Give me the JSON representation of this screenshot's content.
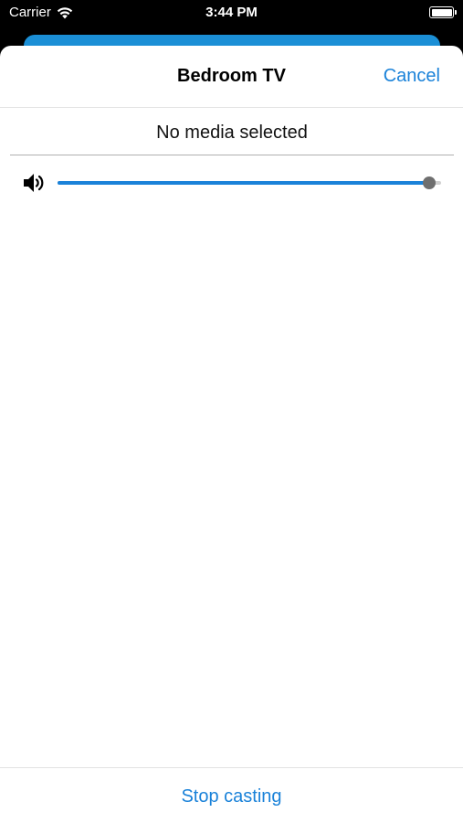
{
  "status_bar": {
    "carrier": "Carrier",
    "time": "3:44 PM",
    "icons": [
      "wifi-icon",
      "battery-icon"
    ]
  },
  "sheet": {
    "title": "Bedroom TV",
    "cancel_label": "Cancel",
    "media_status": "No media selected"
  },
  "volume": {
    "icon": "speaker-icon",
    "level": 0.97
  },
  "footer": {
    "stop_label": "Stop casting"
  },
  "colors": {
    "accent": "#1a82d9",
    "underlay": "#1b8fd6",
    "thumb": "#6f6f6f"
  }
}
